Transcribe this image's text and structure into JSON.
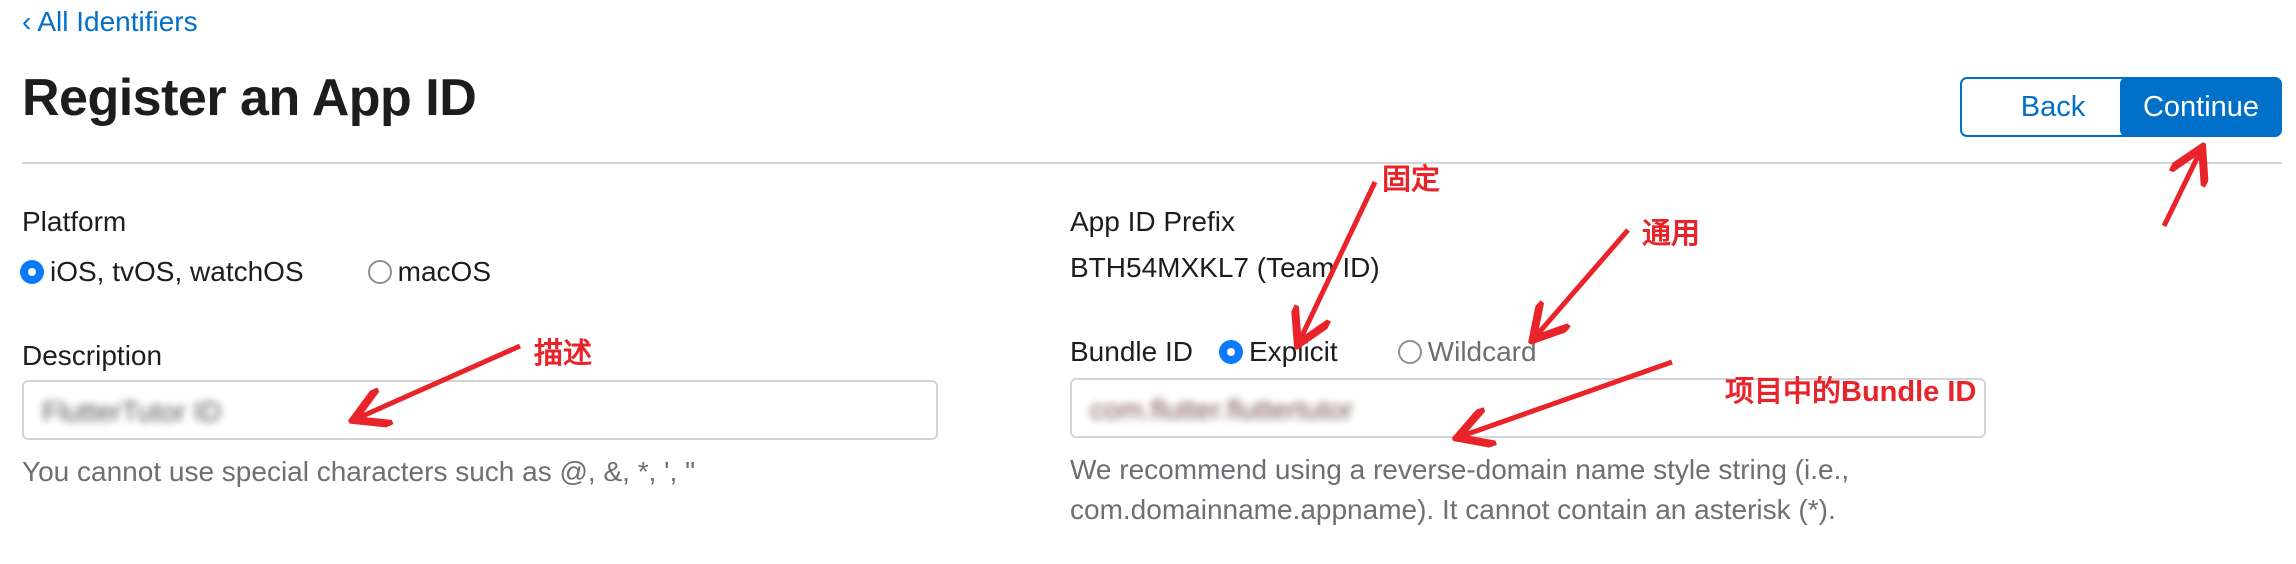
{
  "nav": {
    "back_link": "All Identifiers",
    "chevron": "‹"
  },
  "page_title": "Register an App ID",
  "buttons": {
    "back": "Back",
    "continue": "Continue"
  },
  "platform": {
    "label": "Platform",
    "options": [
      {
        "label": "iOS, tvOS, watchOS",
        "selected": true
      },
      {
        "label": "macOS",
        "selected": false
      }
    ]
  },
  "app_id_prefix": {
    "label": "App ID Prefix",
    "value": "BTH54MXKL7 (Team ID)"
  },
  "description": {
    "label": "Description",
    "value": "FlutterTutor ID",
    "helper": "You cannot use special characters such as @, &, *, ', \""
  },
  "bundle_id": {
    "label": "Bundle ID",
    "options": [
      {
        "label": "Explicit",
        "selected": true
      },
      {
        "label": "Wildcard",
        "selected": false
      }
    ],
    "value": "com.flutter.fluttertutor",
    "helper_line1": "We recommend using a reverse-domain name style string (i.e.,",
    "helper_line2": "com.domainname.appname). It cannot contain an asterisk (*)."
  },
  "annotations": {
    "fixed": "固定",
    "general": "通用",
    "describe": "描述",
    "project_bundle_id": "项目中的Bundle ID"
  },
  "colors": {
    "accent": "#0070c9",
    "annotation": "#e8242a",
    "radio_selected": "#0a7aff"
  }
}
